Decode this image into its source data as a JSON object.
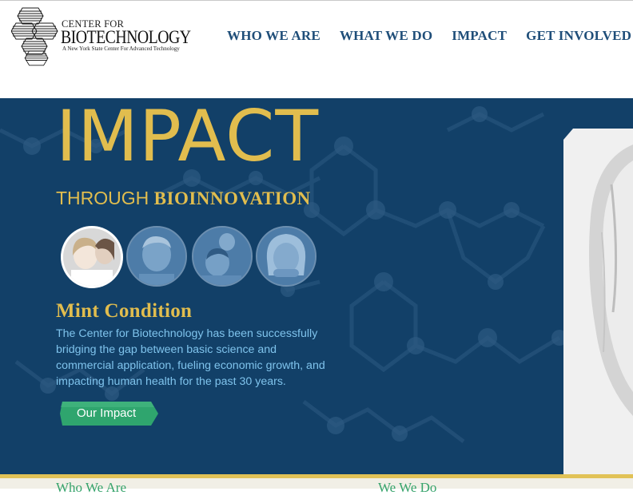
{
  "logo": {
    "line1": "CENTER FOR",
    "line2": "BIOTECHNOLOGY",
    "tagline": "A New York State Center For Advanced Technology"
  },
  "nav": {
    "items": [
      "WHO WE ARE",
      "WHAT WE DO",
      "IMPACT",
      "GET INVOLVED"
    ]
  },
  "hero": {
    "title": "IMPACT",
    "subtitle_plain": "THROUGH ",
    "subtitle_bold": "BIOINNOVATION",
    "thumbnails": [
      "girl-with-mother",
      "older-man",
      "family",
      "smiling-woman"
    ],
    "selected_thumbnail": 0,
    "heading": "Mint Condition",
    "body": "The Center for Biotechnology has been successfully bridging the gap between basic science and commercial application, fueling economic growth, and impacting human health for the past 30 years.",
    "cta": "Our Impact"
  },
  "footer": {
    "col1": "Who We Are",
    "col2": "We We Do"
  },
  "colors": {
    "navy": "#124068",
    "gold": "#e1bd4e",
    "nav_text": "#1f4e79",
    "body_text": "#7fc3ec",
    "cta_green": "#2fa56e"
  }
}
